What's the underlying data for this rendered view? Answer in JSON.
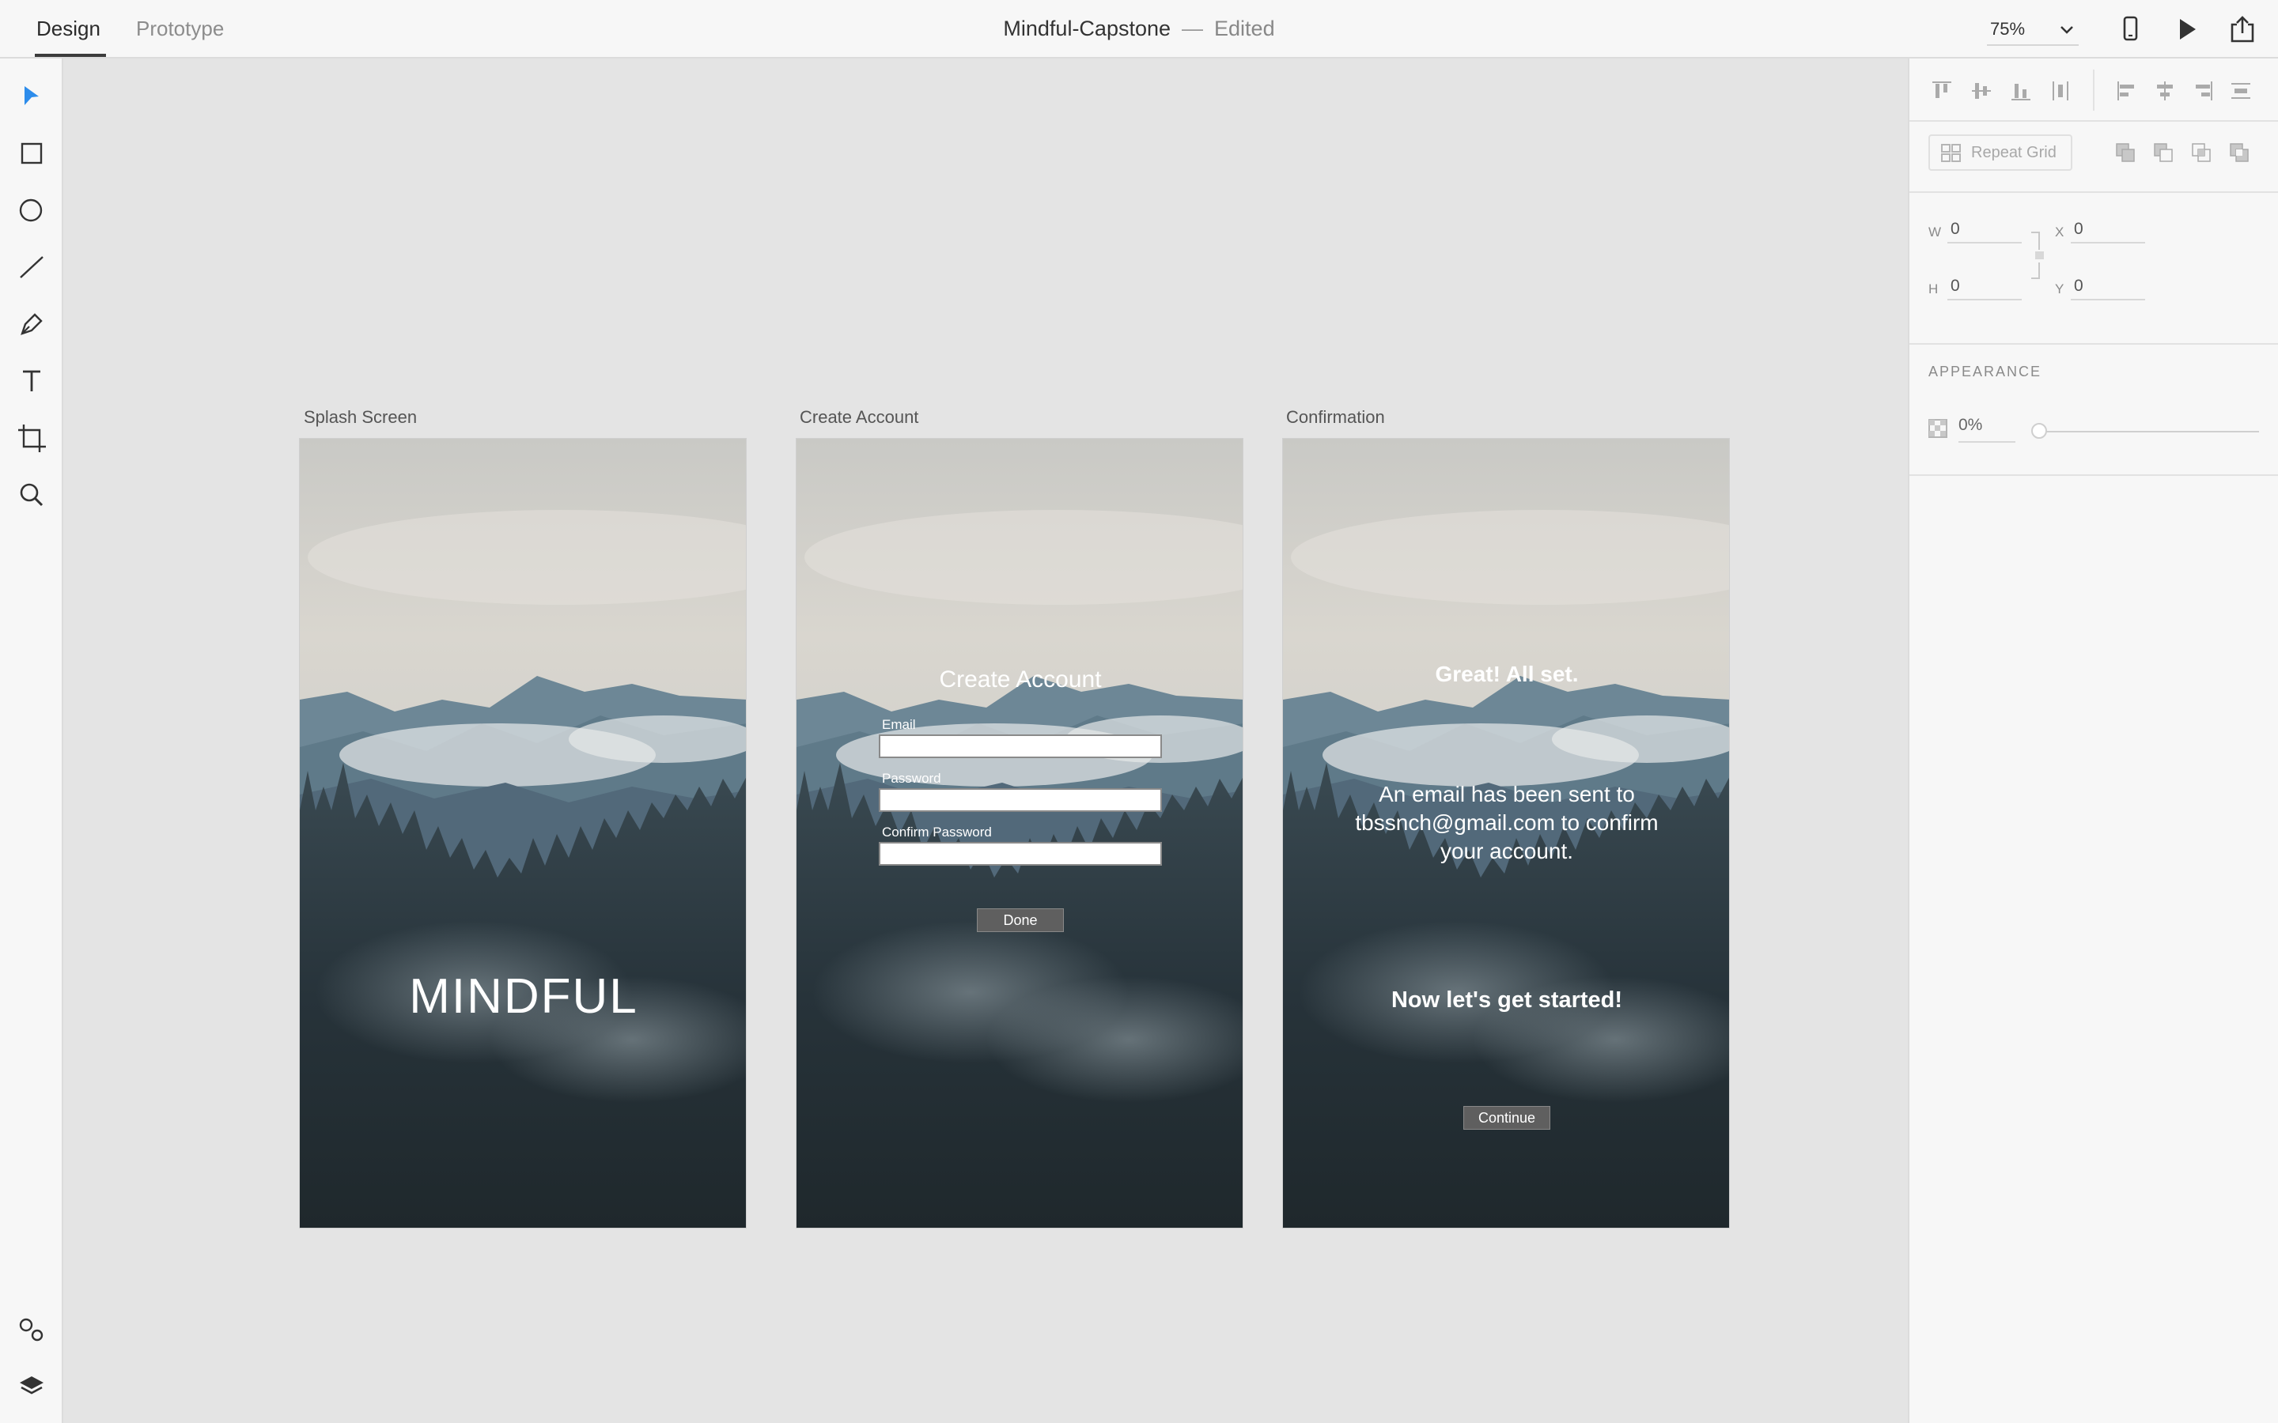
{
  "topbar": {
    "tabs": {
      "design": "Design",
      "prototype": "Prototype"
    },
    "document_title": "Mindful-Capstone",
    "separator": "—",
    "status": "Edited",
    "zoom": "75%"
  },
  "right_panel": {
    "repeat_grid_label": "Repeat Grid",
    "w_label": "W",
    "h_label": "H",
    "x_label": "X",
    "y_label": "Y",
    "w_value": "0",
    "h_value": "0",
    "x_value": "0",
    "y_value": "0",
    "appearance_title": "APPEARANCE",
    "opacity": "0%",
    "opacity_level": 0
  },
  "artboards": {
    "splash": {
      "label": "Splash Screen",
      "brand": "MINDFUL"
    },
    "create_account": {
      "label": "Create Account",
      "heading": "Create Account",
      "email_label": "Email",
      "password_label": "Password",
      "confirm_label": "Confirm Password",
      "done_button": "Done"
    },
    "confirmation": {
      "label": "Confirmation",
      "heading": "Great! All set.",
      "message_line1": "An email has been sent to",
      "message_line2": "tbssnch@gmail.com to confirm",
      "message_line3": "your account.",
      "subheading": "Now let's get started!",
      "continue_button": "Continue"
    }
  },
  "colors": {
    "accent": "#2d8ceb",
    "canvas": "#e4e4e4",
    "panel": "#f7f7f7",
    "button": "#5f5f5f"
  },
  "icons": {
    "left_tools": [
      "select-arrow-icon",
      "rectangle-icon",
      "ellipse-icon",
      "line-icon",
      "pen-icon",
      "text-icon",
      "artboard-icon",
      "zoom-icon"
    ],
    "left_bottom": [
      "symbols-icon",
      "layers-icon"
    ],
    "top_right": [
      "device-preview-icon",
      "play-icon",
      "share-icon"
    ]
  }
}
